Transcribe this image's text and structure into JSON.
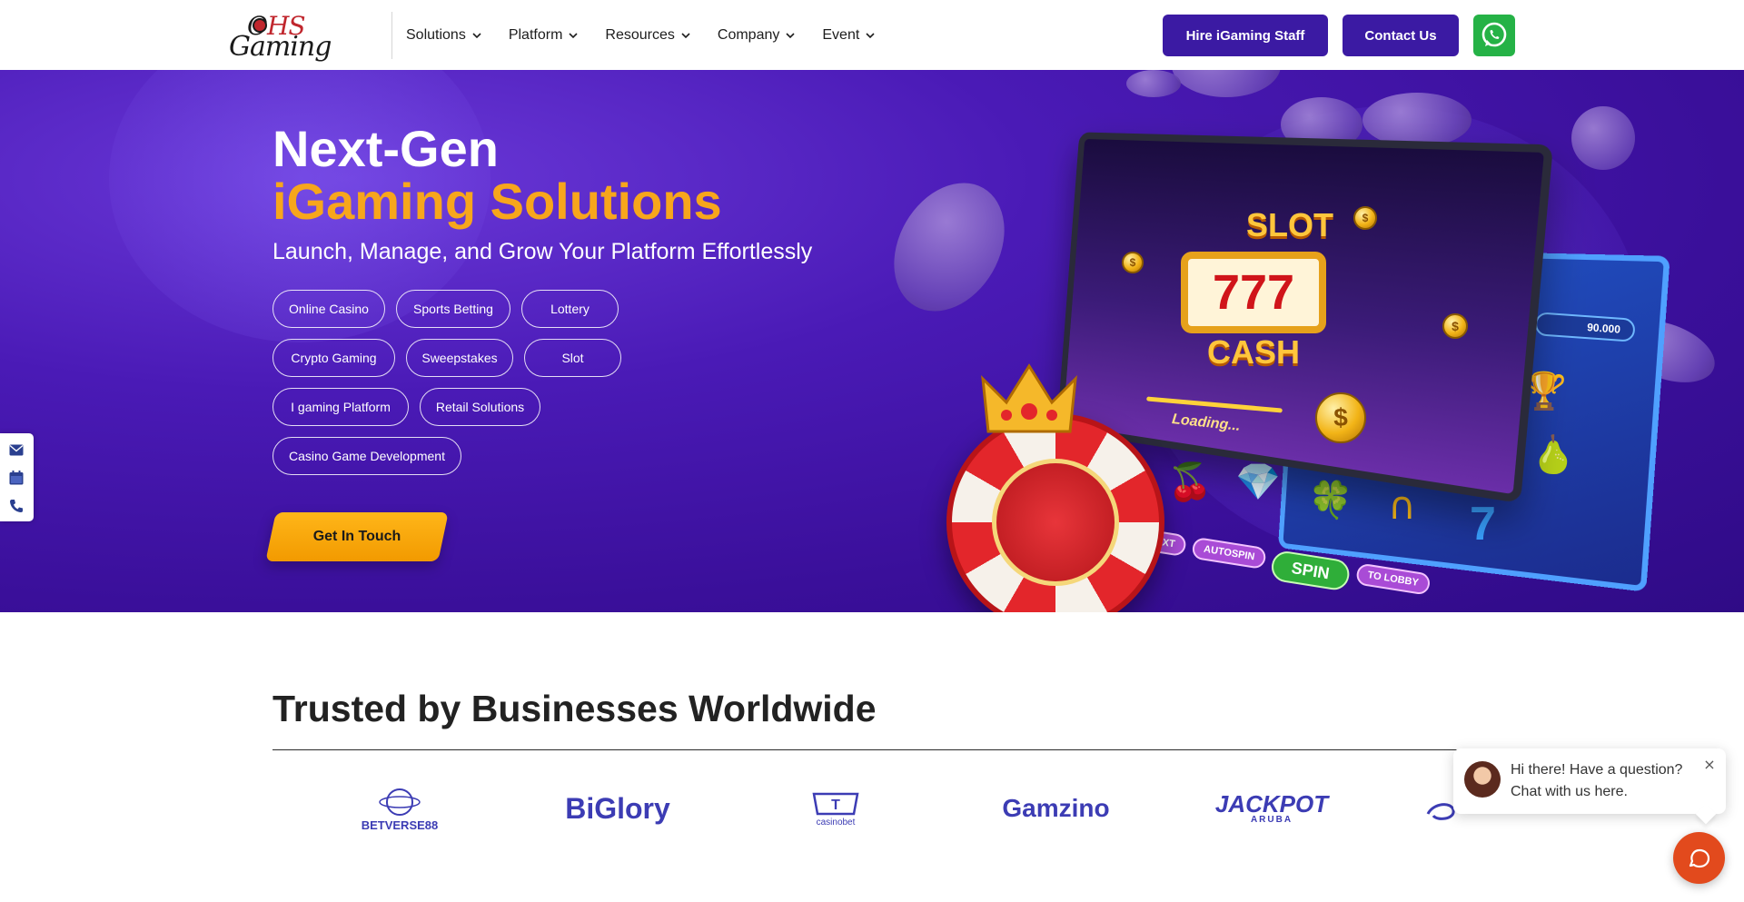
{
  "header": {
    "logo_top": "OHS",
    "logo_bottom": "Gaming",
    "nav": [
      {
        "label": "Solutions"
      },
      {
        "label": "Platform"
      },
      {
        "label": "Resources"
      },
      {
        "label": "Company"
      },
      {
        "label": "Event"
      }
    ],
    "hire_label": "Hire iGaming Staff",
    "contact_label": "Contact Us",
    "whatsapp_icon": "whatsapp-icon"
  },
  "hero": {
    "title_line1": "Next-Gen",
    "title_line2": "iGaming Solutions",
    "subtitle": "Launch, Manage, and Grow Your Platform Effortlessly",
    "tags": [
      "Online Casino",
      "Sports Betting",
      "Lottery",
      "Crypto Gaming",
      "Sweepstakes",
      "Slot",
      "I gaming Platform",
      "Retail Solutions",
      "Casino Game Development"
    ],
    "cta_label": "Get In Touch",
    "illustration": {
      "slot_top": "SLOT",
      "slot_reels": "777",
      "slot_bottom": "CASH",
      "loading": "Loading...",
      "credit": "90.000",
      "buttons": [
        "NEXT",
        "AUTOSPIN",
        "SPIN",
        "TO LOBBY"
      ]
    },
    "accent_color": "#f7a61c",
    "bg_color": "#3a0f9a"
  },
  "side_dock": [
    "mail-icon",
    "calendar-icon",
    "phone-icon"
  ],
  "trusted": {
    "title": "Trusted by Businesses Worldwide",
    "brands": [
      "BETVERSE88",
      "BiGlory",
      "casinobet",
      "Gamzino",
      "JACKPOT",
      "ARUBA"
    ]
  },
  "chat": {
    "message": "Hi there! Have a question? Chat with us here.",
    "close": "×"
  }
}
